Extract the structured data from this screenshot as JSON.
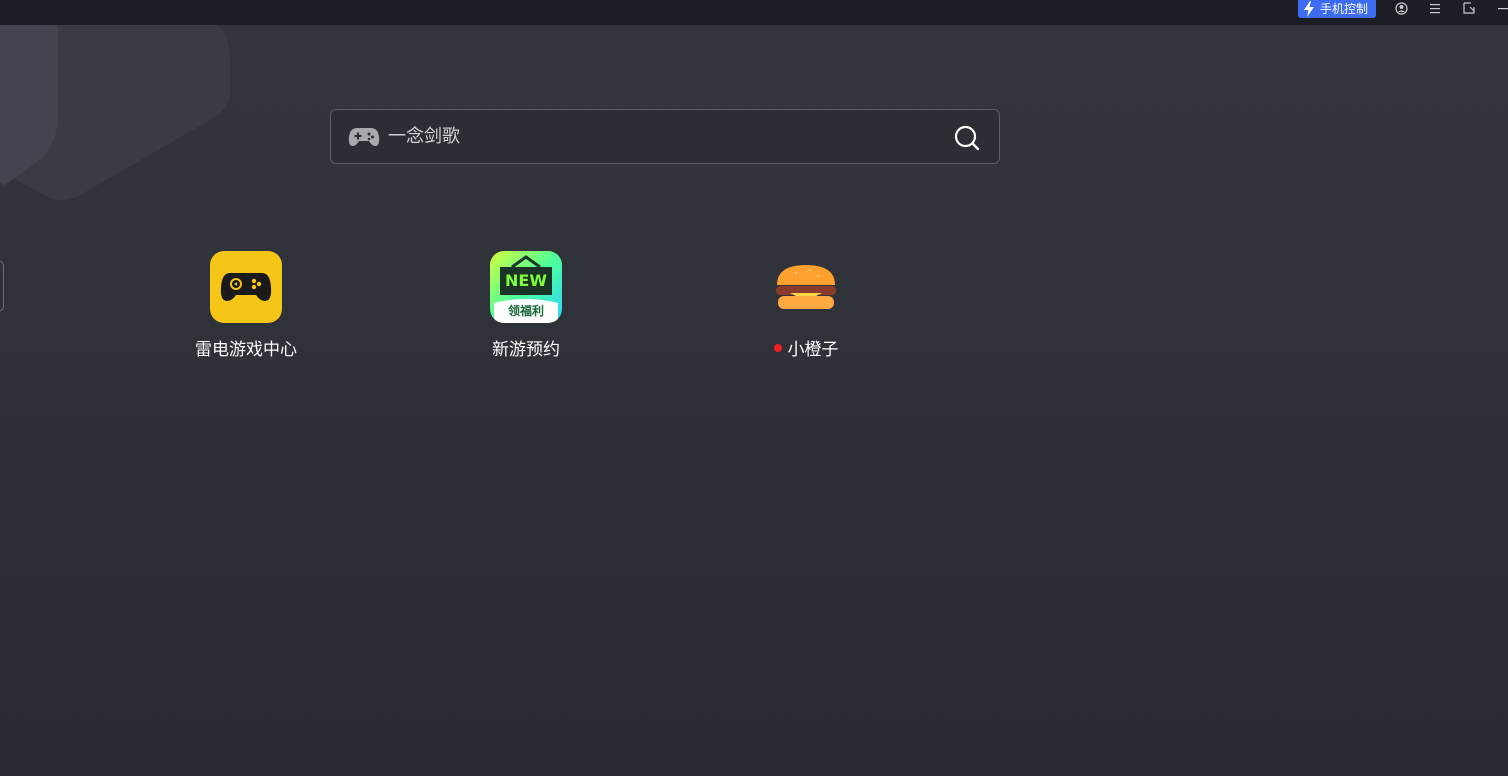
{
  "titlebar": {
    "phone_control_label": "手机控制",
    "icons": [
      "user-icon",
      "menu-icon",
      "window-icon",
      "minimize-icon"
    ],
    "accent_color": "#3d6bf2"
  },
  "search": {
    "value": "一念剑歌",
    "icons": [
      "gamepad-icon",
      "search-icon"
    ]
  },
  "apps": [
    {
      "label": "雷电游戏中心",
      "icon": "gamepad-app-icon",
      "color": "#f5c518"
    },
    {
      "label": "新游预约",
      "icon": "new-games-icon",
      "badge_text": "NEW",
      "sub_text": "领福利"
    },
    {
      "label": "小橙子",
      "icon": "burger-icon",
      "has_notification_dot": true,
      "dot_color": "#f21d1d"
    }
  ]
}
